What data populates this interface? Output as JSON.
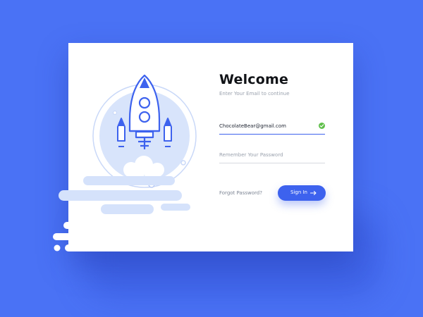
{
  "login": {
    "title": "Welcome",
    "subtitle": "Enter Your Email to continue",
    "email_value": "ChocolateBear@gmail.com",
    "password_placeholder": "Remember Your Password",
    "forgot_link": "Forgot Password?",
    "signin_label": "Sign In"
  },
  "icons": {
    "email_valid": "check-circle-icon",
    "signin_arrow": "arrow-right-icon",
    "illustration": "rocket-launch"
  },
  "colors": {
    "background": "#4a72f5",
    "accent": "#3d62ee",
    "valid": "#5fbf4a",
    "illustration_fill": "#d4e1fb"
  }
}
